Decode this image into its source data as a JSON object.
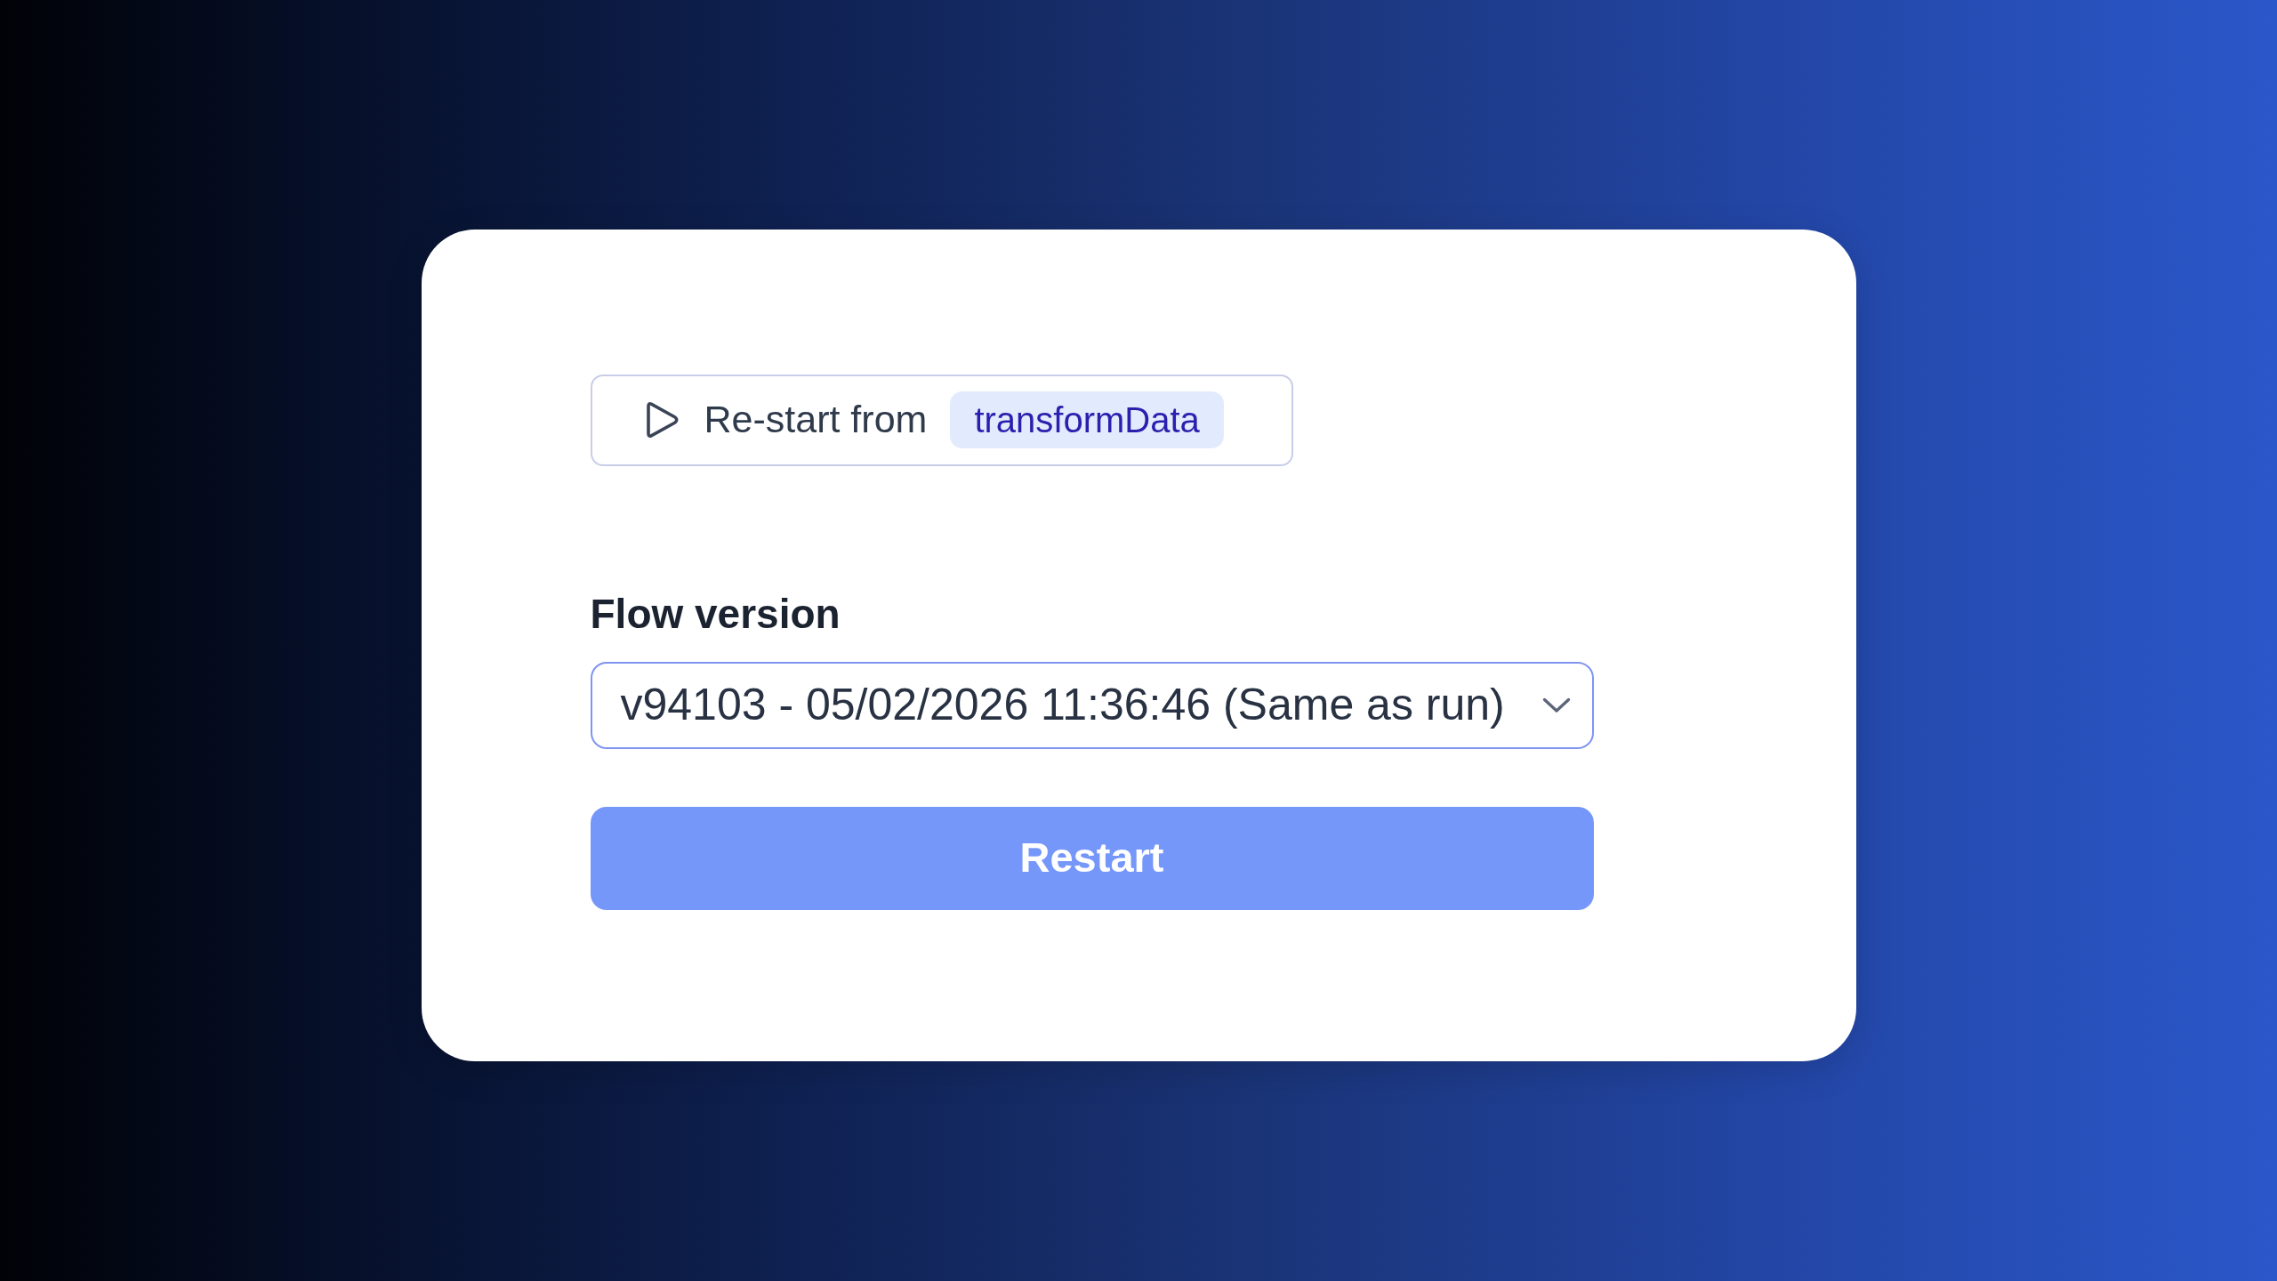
{
  "restart_from": {
    "label": "Re-start from",
    "step": "transformData"
  },
  "flow_version": {
    "label": "Flow version",
    "value": "v94103 - 05/02/2026 11:36:46 (Same as run)"
  },
  "buttons": [
    "Restart"
  ]
}
